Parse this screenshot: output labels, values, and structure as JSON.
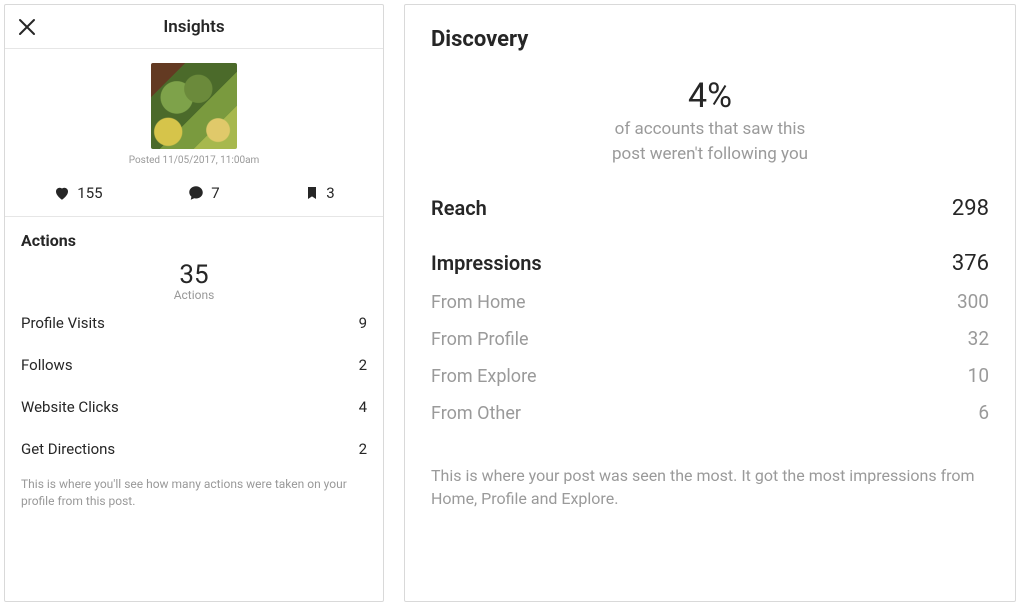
{
  "insights": {
    "title": "Insights",
    "posted": "Posted 11/05/2017, 11:00am",
    "engagement": {
      "likes": "155",
      "comments": "7",
      "saves": "3"
    },
    "actions": {
      "title": "Actions",
      "total": "35",
      "total_label": "Actions",
      "rows": {
        "profile_visits_label": "Profile Visits",
        "profile_visits_value": "9",
        "follows_label": "Follows",
        "follows_value": "2",
        "website_clicks_label": "Website Clicks",
        "website_clicks_value": "4",
        "get_directions_label": "Get Directions",
        "get_directions_value": "2"
      },
      "footnote": "This is where you'll see how many actions were taken on your profile from this post."
    }
  },
  "discovery": {
    "title": "Discovery",
    "percent": "4%",
    "percent_desc_l1": "of accounts that saw this",
    "percent_desc_l2": "post weren't following you",
    "reach_label": "Reach",
    "reach_value": "298",
    "impressions_label": "Impressions",
    "impressions_value": "376",
    "from_home_label": "From Home",
    "from_home_value": "300",
    "from_profile_label": "From Profile",
    "from_profile_value": "32",
    "from_explore_label": "From Explore",
    "from_explore_value": "10",
    "from_other_label": "From Other",
    "from_other_value": "6",
    "footnote": "This is where your post was seen the most. It got the most impressions from Home, Profile and Explore."
  }
}
